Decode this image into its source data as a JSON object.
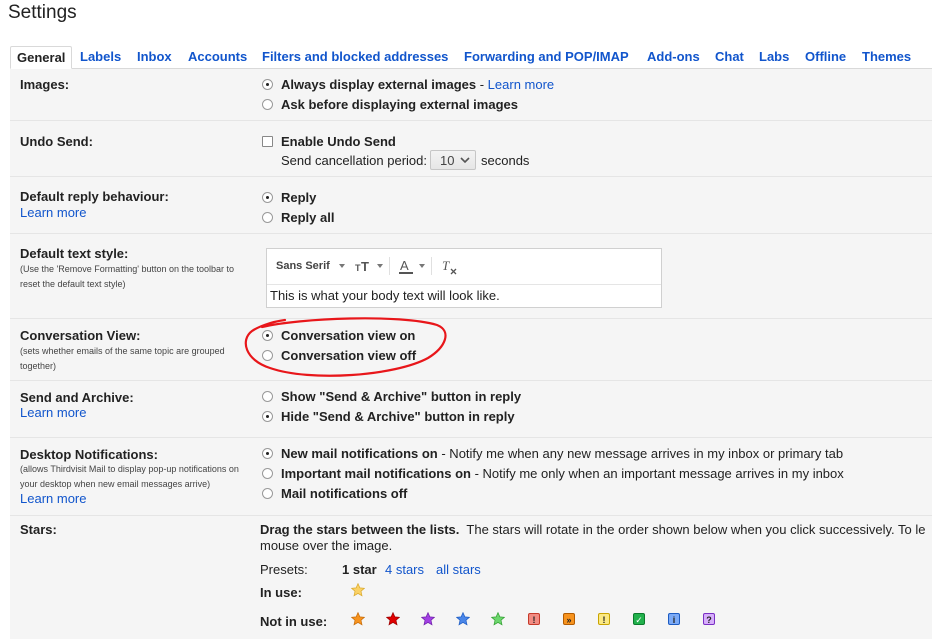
{
  "page_title": "Settings",
  "tabs": [
    {
      "label": "General"
    },
    {
      "label": "Labels"
    },
    {
      "label": "Inbox"
    },
    {
      "label": "Accounts"
    },
    {
      "label": "Filters and blocked addresses"
    },
    {
      "label": "Forwarding and POP/IMAP"
    },
    {
      "label": "Add-ons"
    },
    {
      "label": "Chat"
    },
    {
      "label": "Labs"
    },
    {
      "label": "Offline"
    },
    {
      "label": "Themes"
    }
  ],
  "images": {
    "label": "Images:",
    "opt1": "Always display external images",
    "opt1_sep": " - ",
    "opt1_link": "Learn more",
    "opt2": "Ask before displaying external images"
  },
  "undo_send": {
    "label": "Undo Send:",
    "checkbox_label": "Enable Undo Send",
    "period_label": "Send cancellation period:",
    "period_value": "10",
    "period_unit": "seconds"
  },
  "reply": {
    "label": "Default reply behaviour:",
    "learn_more": "Learn more",
    "opt1": "Reply",
    "opt2": "Reply all"
  },
  "text_style": {
    "label": "Default text style:",
    "desc": "(Use the 'Remove Formatting' button on the toolbar to reset the default text style)",
    "font_name": "Sans Serif",
    "preview": "This is what your body text will look like."
  },
  "conversation": {
    "label": "Conversation View:",
    "desc": "(sets whether emails of the same topic are grouped together)",
    "opt1": "Conversation view on",
    "opt2": "Conversation view off",
    "annotation_color": "#e8161a"
  },
  "send_archive": {
    "label": "Send and Archive:",
    "learn_more": "Learn more",
    "opt1": "Show \"Send & Archive\" button in reply",
    "opt2": "Hide \"Send & Archive\" button in reply"
  },
  "notifications": {
    "label": "Desktop Notifications:",
    "desc": "(allows Thirdvisit Mail to display pop-up notifications on your desktop when new email messages arrive)",
    "learn_more": "Learn more",
    "opt1_bold": "New mail notifications on",
    "opt1_rest": " - Notify me when any new message arrives in my inbox or primary tab",
    "opt2_bold": "Important mail notifications on",
    "opt2_rest": " - Notify me only when an important message arrives in my inbox",
    "opt3": "Mail notifications off"
  },
  "stars": {
    "label": "Stars:",
    "desc_bold": "Drag the stars between the lists.",
    "desc_rest": "  The stars will rotate in the order shown below when you click successively. To le",
    "desc_line2": "mouse over the image.",
    "presets_label": "Presets:",
    "preset1": "1 star",
    "preset2": "4 stars",
    "preset3": "all stars",
    "in_use_label": "In use:",
    "not_in_use_label": "Not in use:",
    "in_use_icons": [
      "yellow-star"
    ],
    "not_in_use_icons": [
      "orange-star",
      "red-star",
      "purple-star",
      "blue-star",
      "green-star",
      "red-bang",
      "orange-guillemet",
      "yellow-bang",
      "green-check",
      "blue-info",
      "purple-question"
    ],
    "colors": {
      "yellow": "#fad165",
      "orange": "#f7931e",
      "red": "#e00000",
      "purple": "#a240e3",
      "blue": "#4a86e8",
      "green": "#6dd66d"
    }
  },
  "colors": {
    "link": "#1155cc",
    "panel_bg": "#f5f5f5",
    "text": "#222222"
  }
}
